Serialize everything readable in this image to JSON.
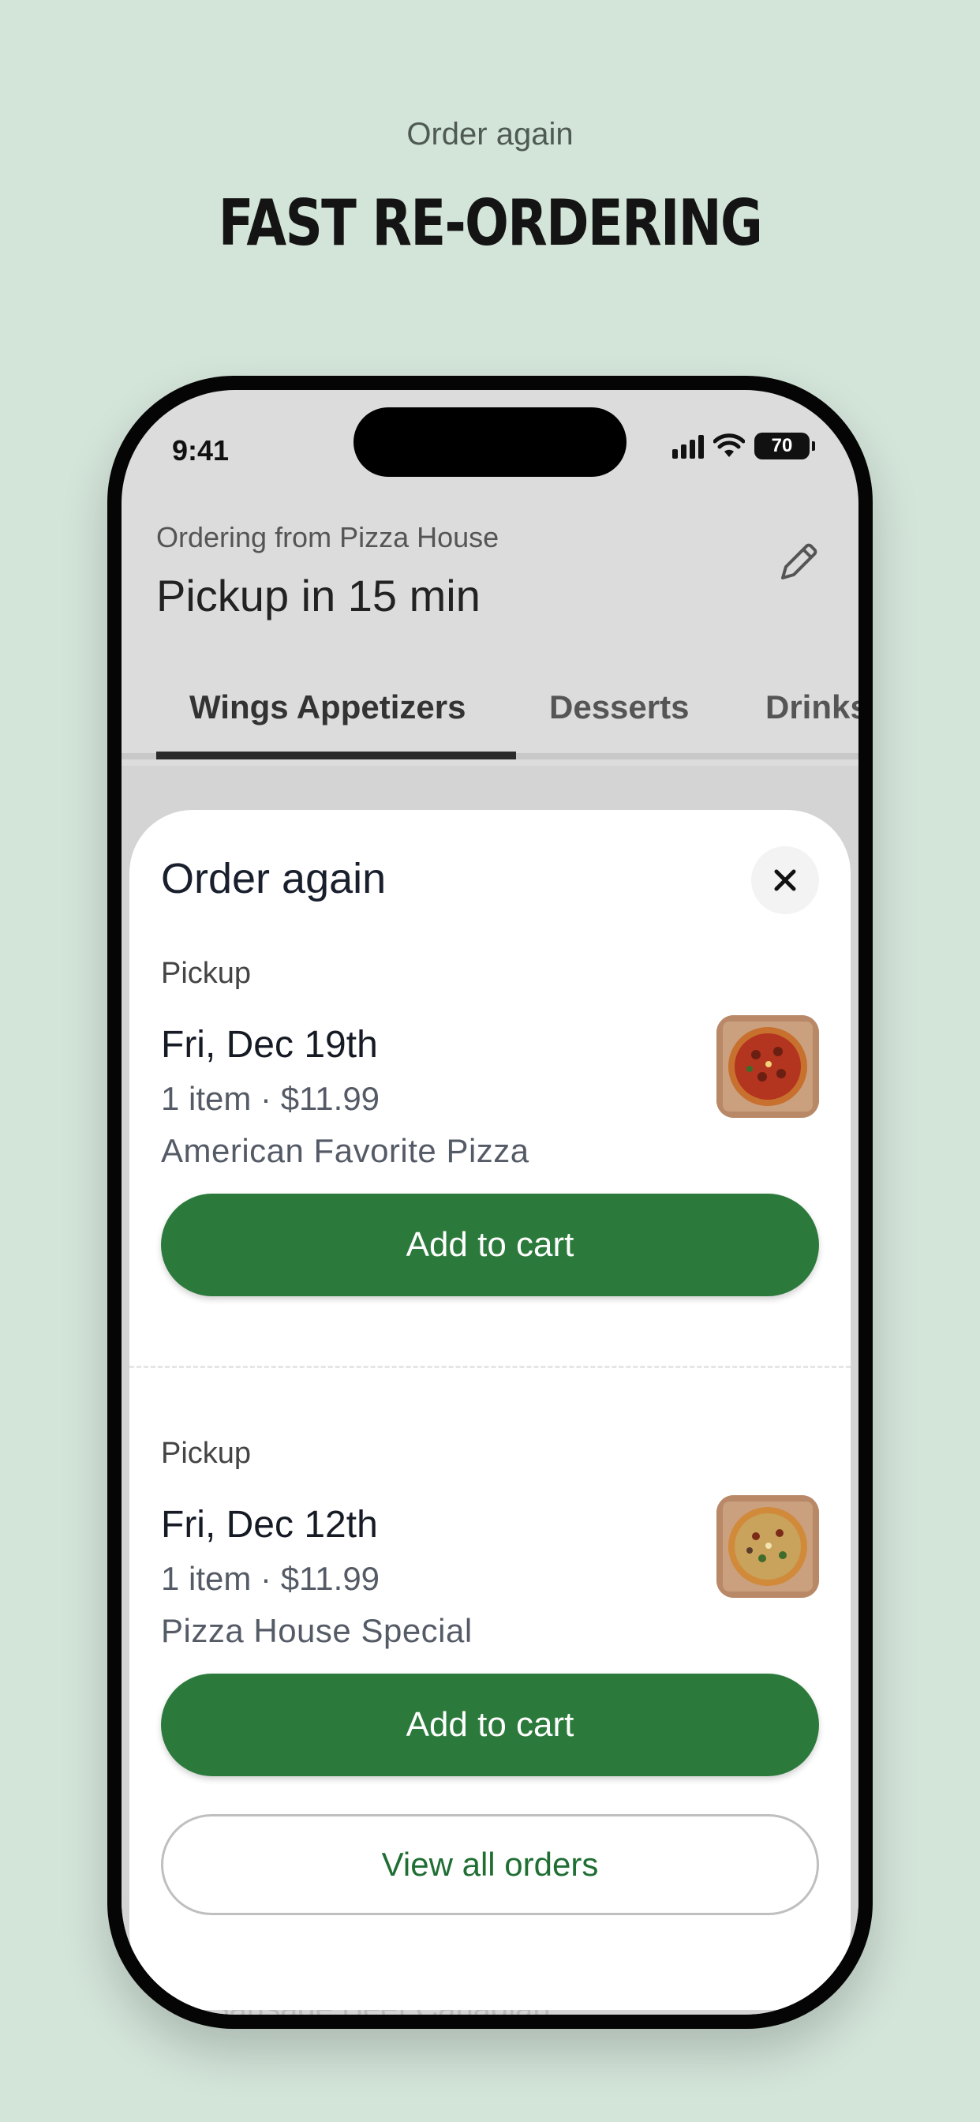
{
  "promo": {
    "subtitle": "Order again",
    "title": "FAST RE-ORDERING"
  },
  "status_bar": {
    "time": "9:41",
    "battery": "70",
    "icons": [
      "signal-icon",
      "wifi-icon",
      "battery-icon"
    ]
  },
  "header": {
    "ordering_from": "Ordering from Pizza House",
    "pickup_time": "Pickup in 15 min",
    "edit_icon": "pencil-icon"
  },
  "tabs": [
    {
      "label": "Wings Appetizers",
      "active": true
    },
    {
      "label": "Desserts",
      "active": false
    },
    {
      "label": "Drinks",
      "active": false
    }
  ],
  "behind_content": {
    "text": "Sausage Beef Canadian"
  },
  "sheet": {
    "title": "Order again",
    "close_icon": "close-icon",
    "orders": [
      {
        "type": "Pickup",
        "date": "Fri, Dec 19th",
        "meta": "1 item · $11.99",
        "item_name": "American Favorite Pizza",
        "button": "Add to cart"
      },
      {
        "type": "Pickup",
        "date": "Fri, Dec 12th",
        "meta": "1 item · $11.99",
        "item_name": "Pizza House Special",
        "button": "Add to cart"
      }
    ],
    "view_all": "View all orders"
  },
  "colors": {
    "background": "#d3e4d9",
    "primary_button": "#2b7a3b",
    "link_green": "#1f6e33"
  }
}
